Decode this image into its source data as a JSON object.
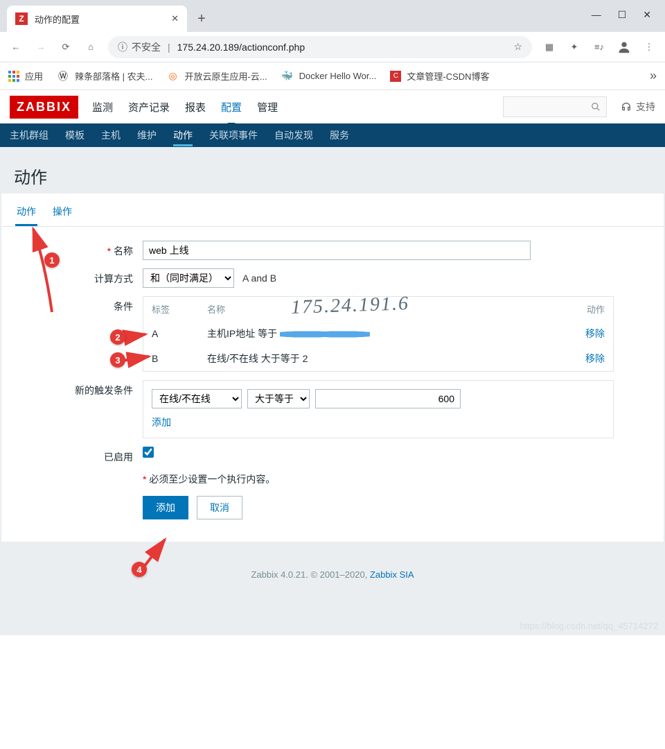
{
  "browser": {
    "tab_title": "动作的配置",
    "url_warning": "不安全",
    "url": "175.24.20.189/actionconf.php",
    "bookmarks": [
      {
        "label": "应用"
      },
      {
        "label": "辣条部落格 | 农夫..."
      },
      {
        "label": "开放云原生应用-云..."
      },
      {
        "label": "Docker Hello Wor..."
      },
      {
        "label": "文章管理-CSDN博客"
      }
    ]
  },
  "zabbix": {
    "logo": "ZABBIX",
    "top_menu": [
      "监测",
      "资产记录",
      "报表",
      "配置",
      "管理"
    ],
    "top_active": 3,
    "support": "支持",
    "sub_menu": [
      "主机群组",
      "模板",
      "主机",
      "维护",
      "动作",
      "关联项事件",
      "自动发现",
      "服务"
    ],
    "sub_active": 4
  },
  "page": {
    "title": "动作",
    "tabs": [
      "动作",
      "操作"
    ],
    "tabs_active": 0,
    "form": {
      "name_label": "名称",
      "name_value": "web 上线",
      "calc_label": "计算方式",
      "calc_select_option": "和（同时满足）",
      "calc_formula": "A and B",
      "conditions_label": "条件",
      "cond_headers": {
        "tag": "标签",
        "name": "名称",
        "action": "动作"
      },
      "conditions": [
        {
          "tag": "A",
          "name": "主机IP地址 等于",
          "action": "移除"
        },
        {
          "tag": "B",
          "name": "在线/不在线 大于等于 2",
          "action": "移除"
        }
      ],
      "new_cond_label": "新的触发条件",
      "new_cond_type": "在线/不在线",
      "new_cond_op": "大于等于",
      "new_cond_value": "600",
      "new_cond_add": "添加",
      "enabled_label": "已启用",
      "enabled_checked": true,
      "warning": "必须至少设置一个执行内容。",
      "submit": "添加",
      "cancel": "取消"
    }
  },
  "footer": {
    "text_prefix": "Zabbix 4.0.21. © 2001–2020, ",
    "link": "Zabbix SIA"
  },
  "annotations": {
    "badges": [
      "1",
      "2",
      "3",
      "4"
    ],
    "handwriting": "175.24.191.6"
  },
  "watermark": "https://blog.csdn.net/qq_45714272"
}
